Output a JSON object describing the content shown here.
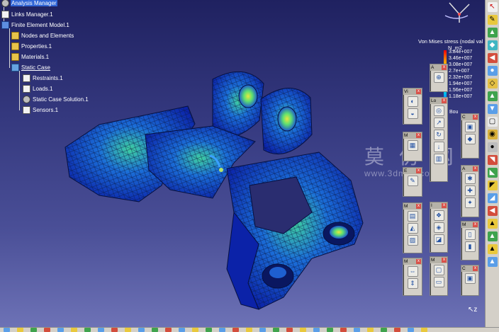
{
  "tree": {
    "root": "Analysis Manager",
    "links": "Links Manager.1",
    "fem": "Finite Element Model.1",
    "nodes": "Nodes and Elements",
    "properties": "Properties.1",
    "materials": "Materials.1",
    "static_case": "Static Case",
    "restraints": "Restraints.1",
    "loads": "Loads.1",
    "solution": "Static Case Solution.1",
    "sensors": "Sensors.1"
  },
  "legend": {
    "title": "Von Mises stress (nodal val",
    "unit": "N_m2",
    "values": [
      "3.84e+007",
      "3.46e+007",
      "3.08e+007",
      "2.7e+007",
      "2.32e+007",
      "1.94e+007",
      "1.56e+007",
      "1.18e+007"
    ],
    "footer": "Bou",
    "colors": {
      "max": "#ff0000",
      "min": "#0000ff"
    }
  },
  "toolbars": {
    "a1": "A",
    "vi": "Vi",
    "lo": "Lo",
    "c1": "C",
    "m1": "M",
    "e1": "E",
    "a2": "A",
    "i1": "I",
    "m2": "M",
    "m3": "M",
    "c2": "C",
    "m4": "M",
    "close": "x"
  },
  "watermark": {
    "cn": "莫 仿 网",
    "en": "www.3dmax.com"
  },
  "icons": {
    "compass": "compass-icon",
    "axis": "axis-triad-icon"
  },
  "axis_label": "z",
  "colors": {
    "background_top": "#1f2160",
    "background_bottom": "#6d72b6",
    "selection": "#2f64d6"
  }
}
